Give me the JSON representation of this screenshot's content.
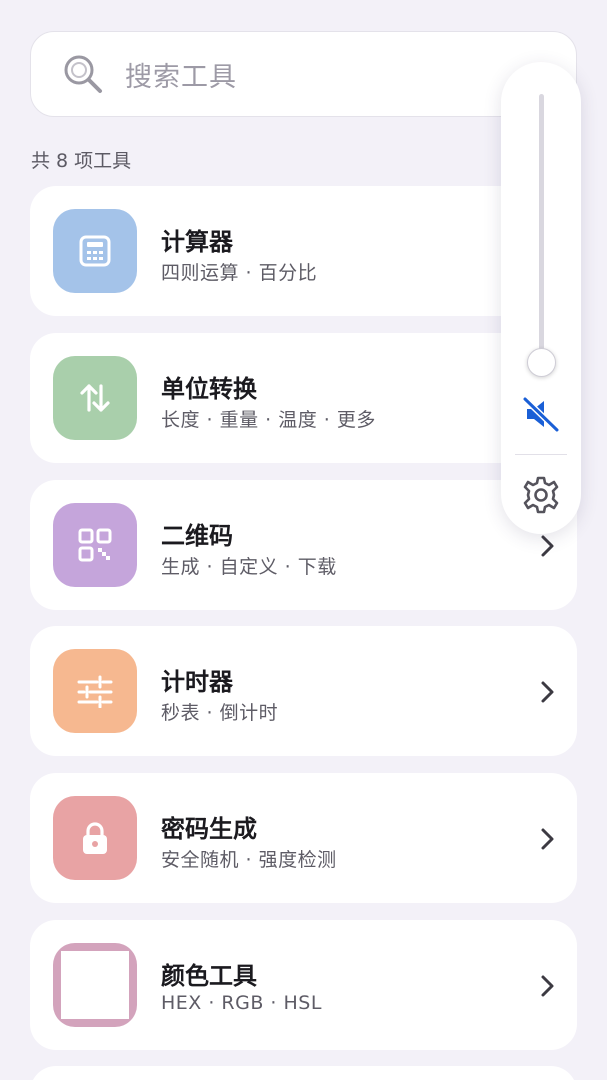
{
  "search": {
    "placeholder": "搜索工具",
    "icon": "search-icon"
  },
  "summary": {
    "count_text": "共 8 项工具"
  },
  "tools": [
    {
      "title": "计算器",
      "subtitle": "四则运算 · 百分比",
      "icon": "calculator-icon",
      "color": "#a4c3e9"
    },
    {
      "title": "单位转换",
      "subtitle": "长度 · 重量 · 温度 · 更多",
      "icon": "swap-arrows-icon",
      "color": "#a9cfab"
    },
    {
      "title": "二维码",
      "subtitle": "生成 · 自定义 · 下载",
      "icon": "qr-code-icon",
      "color": "#c5a5db"
    },
    {
      "title": "计时器",
      "subtitle": "秒表 · 倒计时",
      "icon": "timer-sliders-icon",
      "color": "#f6b890"
    },
    {
      "title": "密码生成",
      "subtitle": "安全随机 · 强度检测",
      "icon": "lock-icon",
      "color": "#e8a3a4"
    },
    {
      "title": "颜色工具",
      "subtitle": "HEX · RGB · HSL",
      "icon": "color-swatch-icon",
      "color": "#d3a3bc"
    }
  ],
  "volume_panel": {
    "level": 0,
    "muted": true,
    "accent_color": "#1a5fd6",
    "mute_icon": "volume-mute-icon",
    "settings_icon": "gear-icon"
  }
}
